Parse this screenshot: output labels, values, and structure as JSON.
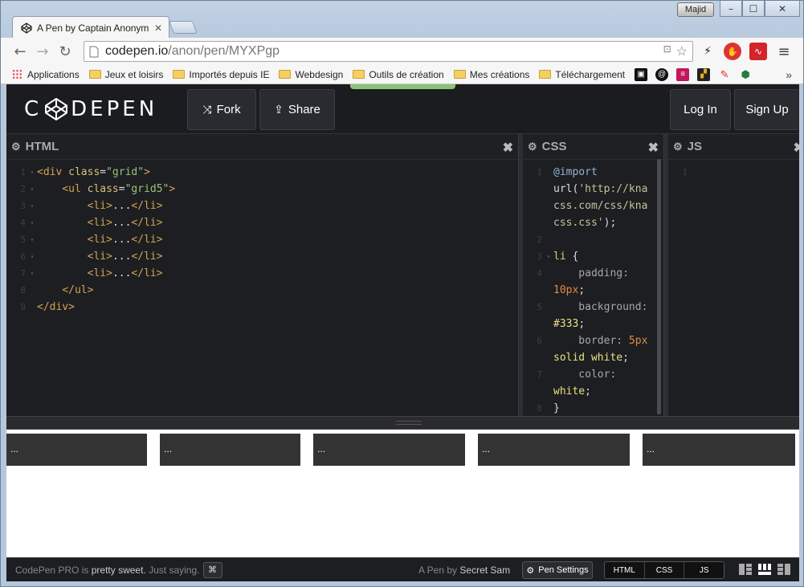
{
  "browser": {
    "user": "Majid",
    "tab_title": "A Pen by Captain Anonym",
    "url_host": "codepen.io",
    "url_path": "/anon/pen/MYXPgp",
    "bookmarks": [
      {
        "label": "Applications",
        "type": "apps"
      },
      {
        "label": "Jeux et loisirs",
        "type": "folder"
      },
      {
        "label": "Importés depuis IE",
        "type": "folder"
      },
      {
        "label": "Webdesign",
        "type": "folder"
      },
      {
        "label": "Outils de création",
        "type": "folder"
      },
      {
        "label": "Mes créations",
        "type": "folder"
      },
      {
        "label": "Téléchargement",
        "type": "folder"
      }
    ],
    "more": "»"
  },
  "codepen": {
    "logo": "CODEPEN",
    "fork_label": "Fork",
    "share_label": "Share",
    "login_label": "Log In",
    "signup_label": "Sign Up",
    "html_title": "HTML",
    "css_title": "CSS",
    "js_title": "JS",
    "cell_text": "...",
    "footer": {
      "pro_a": "CodePen PRO",
      "pro_b": "is",
      "pro_c": "pretty sweet.",
      "pro_d": "Just saying.",
      "kbd": "⌘",
      "by_a": "A Pen",
      "by_b": "by",
      "by_c": "Secret Sam",
      "pen_settings": "Pen Settings",
      "views": [
        "HTML",
        "CSS",
        "JS"
      ]
    }
  }
}
